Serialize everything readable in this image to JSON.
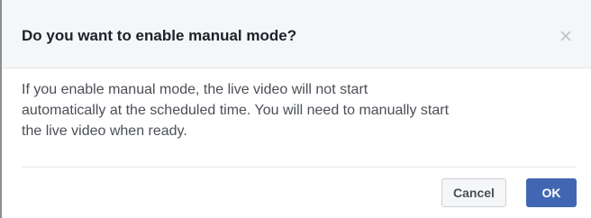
{
  "dialog": {
    "title": "Do you want to enable manual mode?",
    "close_icon": "close-icon",
    "close_glyph": "×",
    "message_line1": "If you enable manual mode, the live video will not start",
    "message_line2": "automatically at the scheduled time. You will need to manually start",
    "message_line3": "the live video when ready.",
    "cancel_label": "Cancel",
    "ok_label": "OK"
  },
  "colors": {
    "primary": "#4267b2",
    "header_bg": "#f5f6f7",
    "title_text": "#1d2129",
    "body_text": "#4b4f56",
    "close_icon": "#bec2c9"
  }
}
